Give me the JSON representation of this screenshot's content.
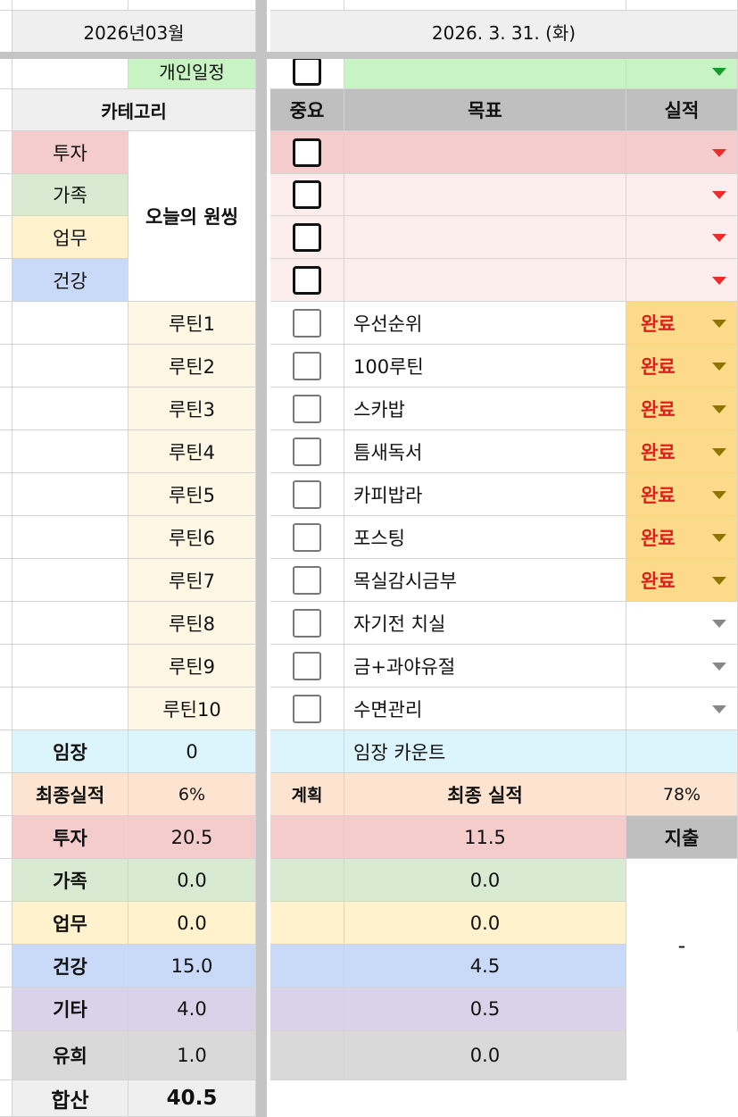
{
  "header": {
    "month": "2026년03월",
    "date": "2026. 3. 31. (화)"
  },
  "top_row": {
    "label": "개인일정"
  },
  "category": {
    "header": "카테고리",
    "items": [
      "투자",
      "가족",
      "업무",
      "건강"
    ],
    "wish_label": "오늘의 원씽"
  },
  "goals_header": {
    "important": "중요",
    "goal": "목표",
    "result": "실적"
  },
  "routines": [
    {
      "label": "루틴1",
      "goal": "우선순위",
      "status": "완료"
    },
    {
      "label": "루틴2",
      "goal": "100루틴",
      "status": "완료"
    },
    {
      "label": "루틴3",
      "goal": "스카밥",
      "status": "완료"
    },
    {
      "label": "루틴4",
      "goal": "틈새독서",
      "status": "완료"
    },
    {
      "label": "루틴5",
      "goal": "카피밥라",
      "status": "완료"
    },
    {
      "label": "루틴6",
      "goal": "포스팅",
      "status": "완료"
    },
    {
      "label": "루틴7",
      "goal": "목실감시금부",
      "status": "완료"
    },
    {
      "label": "루틴8",
      "goal": "자기전 치실",
      "status": ""
    },
    {
      "label": "루틴9",
      "goal": "금+과야유절",
      "status": ""
    },
    {
      "label": "루틴10",
      "goal": "수면관리",
      "status": ""
    }
  ],
  "attendance": {
    "label": "임장",
    "value": "0",
    "count_label": "임장 카운트"
  },
  "final": {
    "label": "최종실적",
    "value": "6%",
    "plan_label": "계획",
    "result_label": "최종 실적",
    "result_value": "78%"
  },
  "summary": [
    {
      "label": "투자",
      "plan": "20.5",
      "actual": "11.5",
      "bg": "#f4cccc"
    },
    {
      "label": "가족",
      "plan": "0.0",
      "actual": "0.0",
      "bg": "#d9ead3"
    },
    {
      "label": "업무",
      "plan": "0.0",
      "actual": "0.0",
      "bg": "#fff2cc"
    },
    {
      "label": "건강",
      "plan": "15.0",
      "actual": "4.5",
      "bg": "#c9daf8"
    },
    {
      "label": "기타",
      "plan": "4.0",
      "actual": "0.5",
      "bg": "#d9d2e9"
    },
    {
      "label": "유희",
      "plan": "1.0",
      "actual": "0.0",
      "bg": "#d9d9d9"
    }
  ],
  "total": {
    "label": "합산",
    "value": "40.5"
  },
  "expense": {
    "label": "지출",
    "value": "-"
  },
  "colors": {
    "invest": "#f4cccc",
    "family": "#d9ead3",
    "work": "#fff2cc",
    "health": "#c9daf8",
    "etc": "#d9d2e9",
    "fun": "#d9d9d9",
    "routine": "#fff7e6",
    "done": "#fdd98a",
    "wish": "#fdeeee",
    "attend": "#dcf5fc",
    "final": "#fde4d0",
    "header_gray": "#bfbfbf",
    "schedule": "#c8f3c2"
  }
}
